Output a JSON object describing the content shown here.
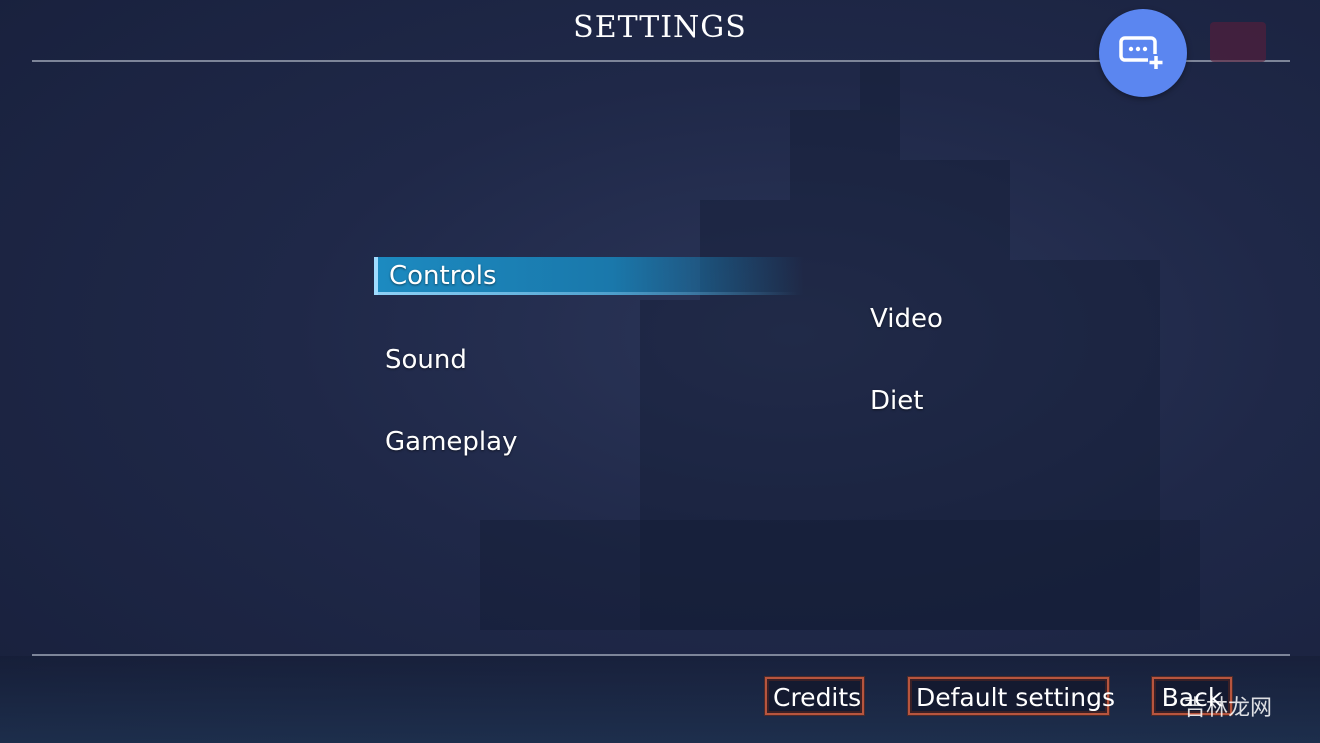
{
  "header": {
    "title": "SETTINGS",
    "chat_button_icon": "chat-add-icon"
  },
  "menu": {
    "left": [
      {
        "label": "Controls",
        "selected": true
      },
      {
        "label": "Sound",
        "selected": false
      },
      {
        "label": "Gameplay",
        "selected": false
      }
    ],
    "right": [
      {
        "label": "Video",
        "selected": false
      },
      {
        "label": "Diet",
        "selected": false
      }
    ]
  },
  "footer": {
    "credits_label": "Credits",
    "default_settings_label": "Default settings",
    "back_label": "Back"
  },
  "watermark": "吉林龙网",
  "colors": {
    "selection": "#1c8ac0",
    "fab": "#5b86f0",
    "button_border": "#b7553e"
  }
}
